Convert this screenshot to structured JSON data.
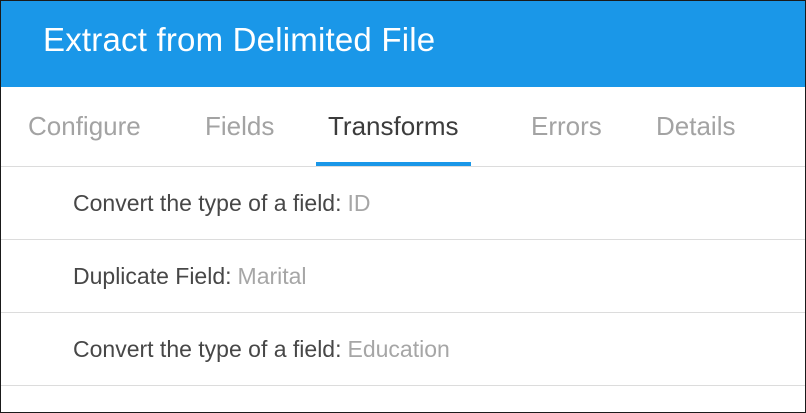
{
  "header": {
    "title": "Extract from Delimited File"
  },
  "tabs": [
    {
      "label": "Configure",
      "active": false
    },
    {
      "label": "Fields",
      "active": false
    },
    {
      "label": "Transforms",
      "active": true
    },
    {
      "label": "Errors",
      "active": false
    },
    {
      "label": "Details",
      "active": false
    }
  ],
  "transforms": [
    {
      "label": "Convert the type of a field:",
      "value": "ID"
    },
    {
      "label": "Duplicate Field:",
      "value": "Marital"
    },
    {
      "label": "Convert the type of a field:",
      "value": "Education"
    }
  ],
  "colors": {
    "accent": "#1a97e8",
    "inactive_tab": "#a3a3a3",
    "active_tab": "#3c3c3c"
  }
}
